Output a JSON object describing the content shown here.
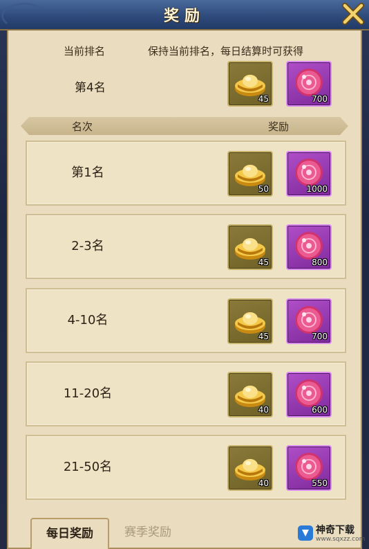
{
  "window": {
    "title": "奖励"
  },
  "header": {
    "current_rank_label": "当前排名",
    "keep_rank_label": "保持当前排名，每日结算时可获得",
    "current_rank_value": "第4名",
    "current_rewards": {
      "gold": "45",
      "gem": "700"
    }
  },
  "table": {
    "col_rank": "名次",
    "col_reward": "奖励",
    "rows": [
      {
        "rank": "第1名",
        "gold": "50",
        "gem": "1000"
      },
      {
        "rank": "2-3名",
        "gold": "45",
        "gem": "800"
      },
      {
        "rank": "4-10名",
        "gold": "45",
        "gem": "700"
      },
      {
        "rank": "11-20名",
        "gold": "40",
        "gem": "600"
      },
      {
        "rank": "21-50名",
        "gold": "40",
        "gem": "550"
      }
    ]
  },
  "tabs": {
    "daily": "每日奖励",
    "season": "赛季奖励"
  },
  "watermark": {
    "title": "神奇下载",
    "url": "www.sqxzz.com"
  },
  "icons": {
    "close": "close-x-icon",
    "gold": "gold-ingot-icon",
    "gem": "pink-gem-icon"
  },
  "colors": {
    "panel": "#e9dcbf",
    "title_bar": "#2f4b7c",
    "gold_slot": "#7a6c2e",
    "gem_slot": "#9a3cb8"
  }
}
